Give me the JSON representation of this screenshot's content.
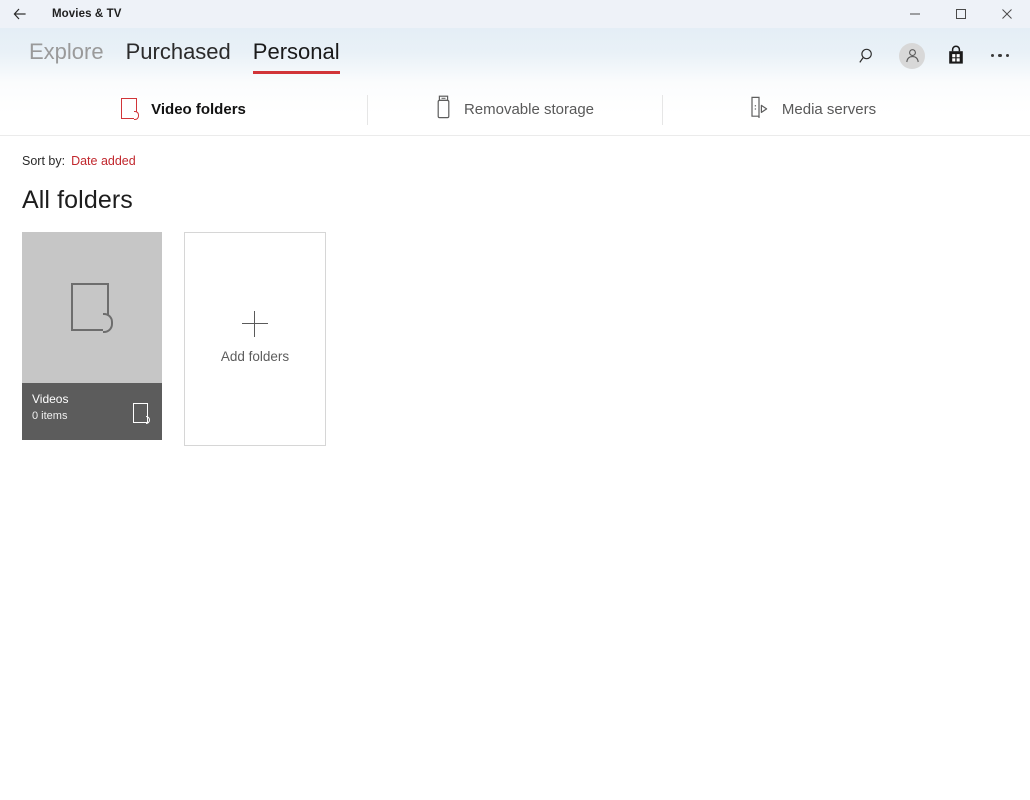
{
  "window": {
    "title": "Movies & TV",
    "back_icon": "back-arrow-icon",
    "controls": {
      "minimize": "minimize-icon",
      "maximize": "maximize-icon",
      "close": "close-icon"
    }
  },
  "nav": {
    "tabs": [
      {
        "label": "Explore",
        "state": "muted"
      },
      {
        "label": "Purchased",
        "state": "normal"
      },
      {
        "label": "Personal",
        "state": "active"
      }
    ],
    "actions": [
      {
        "icon": "search-icon",
        "label": "Search"
      },
      {
        "icon": "account-avatar-icon",
        "label": "Account"
      },
      {
        "icon": "store-bag-icon",
        "label": "Store"
      },
      {
        "icon": "more-ellipsis-icon",
        "label": "See more"
      }
    ],
    "accent_color": "#d13438"
  },
  "subtabs": [
    {
      "label": "Video folders",
      "icon": "video-folder-icon",
      "state": "active"
    },
    {
      "label": "Removable storage",
      "icon": "usb-drive-icon",
      "state": "inactive"
    },
    {
      "label": "Media servers",
      "icon": "media-server-icon",
      "state": "inactive"
    }
  ],
  "content": {
    "sort": {
      "label": "Sort by:",
      "value": "Date added",
      "value_color": "#c1272d"
    },
    "section_title": "All folders",
    "folders": [
      {
        "name": "Videos",
        "count": "0 items",
        "thumb_icon": "folder-icon",
        "badge_icon": "folder-icon"
      }
    ],
    "add_tile": {
      "label": "Add folders",
      "icon": "plus-icon"
    }
  }
}
